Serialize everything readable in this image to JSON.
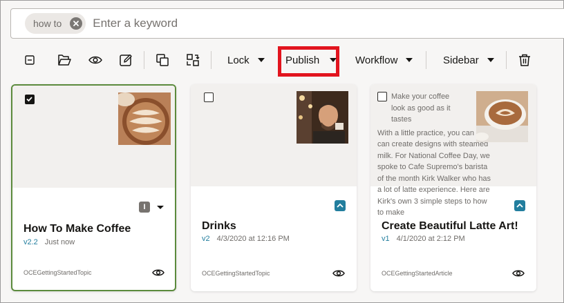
{
  "search": {
    "chip": "how to",
    "placeholder": "Enter a keyword"
  },
  "toolbar": {
    "lock": "Lock",
    "publish": "Publish",
    "workflow": "Workflow",
    "sidebar": "Sidebar",
    "highlight_color": "#e2141e"
  },
  "cards": [
    {
      "title": "How To Make Coffee",
      "version": "v2.2",
      "date": "Just now",
      "type": "OCEGettingStartedTopic",
      "status_badge": "I",
      "checked": true
    },
    {
      "title": "Drinks",
      "version": "v2",
      "date": "4/3/2020 at 12:16 PM",
      "type": "OCEGettingStartedTopic",
      "checked": false
    },
    {
      "title": "Create Beautiful Latte Art!",
      "version": "v1",
      "date": "4/1/2020 at 2:12 PM",
      "type": "OCEGettingStartedArticle",
      "checked": false,
      "preview_heading": "Make your coffee look as good as it tastes",
      "preview_body": "With a little practice, you can too can create designs with steamed milk.  For National Coffee Day, we spoke to Cafe Supremo's barista of the month Kirk Walker who has a lot of latte experience.  Here are Kirk's own 3 simple steps to how to make"
    }
  ],
  "colors": {
    "accent": "#227e9e",
    "selected_border": "#5b8a3c"
  }
}
